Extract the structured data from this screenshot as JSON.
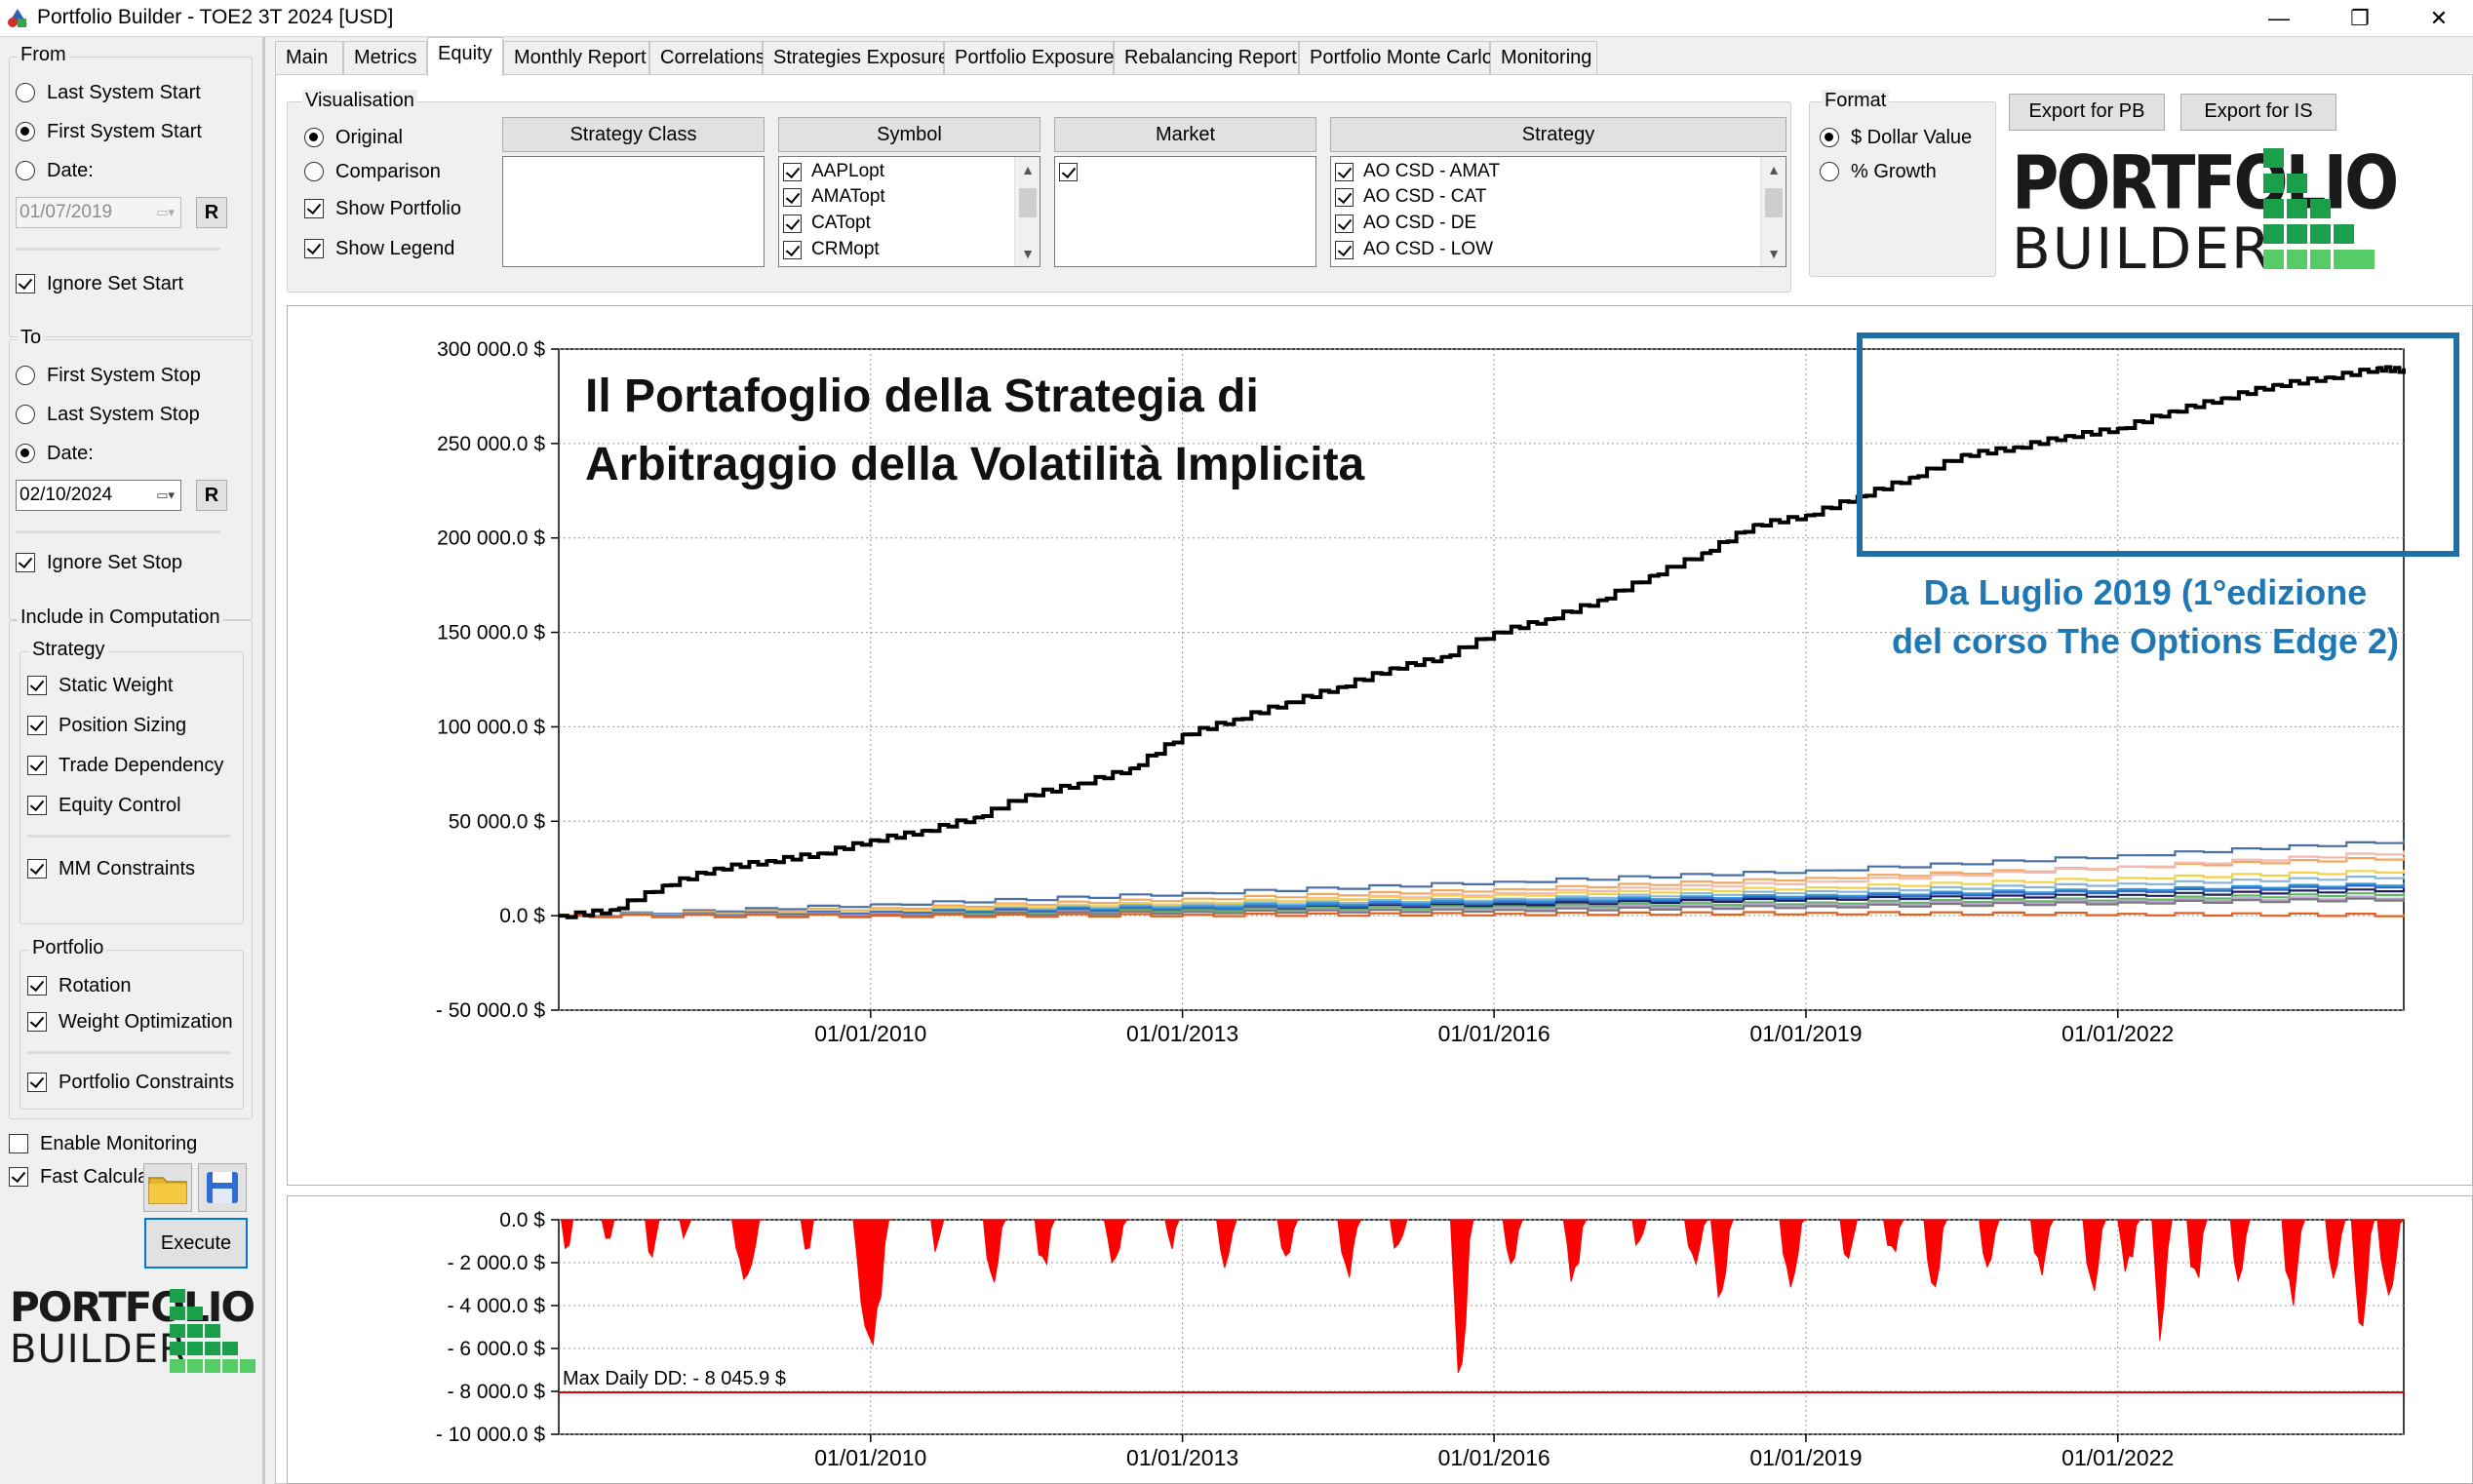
{
  "window": {
    "title": "Portfolio Builder - TOE2 3T 2024 [USD]",
    "controls": {
      "minimize": "—",
      "restore": "❐",
      "close": "✕"
    }
  },
  "left": {
    "from": {
      "label": "From",
      "options": [
        {
          "label": "Last System Start",
          "selected": false
        },
        {
          "label": "First System Start",
          "selected": true
        },
        {
          "label": "Date:",
          "selected": false
        }
      ],
      "date": "01/07/2019",
      "reset_label": "R",
      "ignore_label": "Ignore Set Start",
      "ignore_checked": true
    },
    "to": {
      "label": "To",
      "options": [
        {
          "label": "First System Stop",
          "selected": false
        },
        {
          "label": "Last System Stop",
          "selected": false
        },
        {
          "label": "Date:",
          "selected": true
        }
      ],
      "date": "02/10/2024",
      "reset_label": "R",
      "ignore_label": "Ignore Set Stop",
      "ignore_checked": true
    },
    "include": {
      "label": "Include in Computation",
      "strategy_label": "Strategy",
      "strategy_items": [
        {
          "label": "Static Weight",
          "checked": true
        },
        {
          "label": "Position Sizing",
          "checked": true
        },
        {
          "label": "Trade Dependency",
          "checked": true
        },
        {
          "label": "Equity Control",
          "checked": true
        },
        {
          "label": "MM Constraints",
          "checked": true
        }
      ],
      "portfolio_label": "Portfolio",
      "portfolio_items": [
        {
          "label": "Rotation",
          "checked": true
        },
        {
          "label": "Weight Optimization",
          "checked": true
        },
        {
          "label": "Portfolio Constraints",
          "checked": true
        }
      ]
    },
    "enable_monitoring": {
      "label": "Enable Monitoring",
      "checked": false
    },
    "fast_calculation": {
      "label": "Fast Calculation",
      "checked": true
    },
    "execute_label": "Execute",
    "icons": {
      "open": "folder-icon",
      "save": "floppy-disk-icon"
    }
  },
  "tabs": [
    {
      "label": "Main",
      "active": false
    },
    {
      "label": "Metrics",
      "active": false
    },
    {
      "label": "Equity",
      "active": true
    },
    {
      "label": "Monthly Report",
      "active": false
    },
    {
      "label": "Correlations",
      "active": false
    },
    {
      "label": "Strategies Exposure",
      "active": false
    },
    {
      "label": "Portfolio Exposure",
      "active": false
    },
    {
      "label": "Rebalancing Report",
      "active": false
    },
    {
      "label": "Portfolio Monte Carlo",
      "active": false
    },
    {
      "label": "Monitoring",
      "active": false
    }
  ],
  "visualisation": {
    "label": "Visualisation",
    "options": [
      {
        "label": "Original",
        "selected": true
      },
      {
        "label": "Comparison",
        "selected": false
      }
    ],
    "show_portfolio": {
      "label": "Show Portfolio",
      "checked": true
    },
    "show_legend": {
      "label": "Show Legend",
      "checked": true
    },
    "filters": {
      "strategy_class": {
        "header": "Strategy Class",
        "items": []
      },
      "symbol": {
        "header": "Symbol",
        "items": [
          "AAPLopt",
          "AMATopt",
          "CATopt",
          "CRMopt"
        ]
      },
      "market": {
        "header": "Market",
        "items": [
          ""
        ]
      },
      "strategy": {
        "header": "Strategy",
        "items": [
          "AO CSD - AMAT",
          "AO CSD - CAT",
          "AO CSD - DE",
          "AO CSD - LOW"
        ]
      }
    }
  },
  "format": {
    "label": "Format",
    "options": [
      {
        "label": "$ Dollar Value",
        "selected": true
      },
      {
        "label": "% Growth",
        "selected": false
      }
    ]
  },
  "export": {
    "pb": "Export for PB",
    "is": "Export for IS"
  },
  "logo": {
    "line1": "PORTFOLIO",
    "line2": "BUILDER"
  },
  "overlay": {
    "title_line1": "Il Portafoglio della Strategia di",
    "title_line2": "Arbitraggio della Volatilità Implicita",
    "note_line1": "Da Luglio 2019 (1°edizione",
    "note_line2": "del corso The Options Edge 2)",
    "highlight_color": "#1f6fa6",
    "note_color": "#1f78b4"
  },
  "chart_data": [
    {
      "type": "line",
      "title": "",
      "xlabel": "",
      "ylabel": "",
      "xlim": [
        "2007-01-01",
        "2024-10-02"
      ],
      "ylim": [
        -50000,
        300000
      ],
      "yticks": [
        300000,
        250000,
        200000,
        150000,
        100000,
        50000,
        0,
        -50000
      ],
      "ytick_labels": [
        "300 000.0 $",
        "250 000.0 $",
        "200 000.0 $",
        "150 000.0 $",
        "100 000.0 $",
        "50 000.0 $",
        "0.0 $",
        "- 50 000.0 $"
      ],
      "xticks": [
        "2010-01-01",
        "2013-01-01",
        "2016-01-01",
        "2019-01-01",
        "2022-01-01"
      ],
      "xtick_labels": [
        "01/01/2010",
        "01/01/2013",
        "01/01/2016",
        "01/01/2019",
        "01/01/2022"
      ],
      "grid": true,
      "portfolio": {
        "color": "#000000",
        "x": [
          "2007-01-01",
          "2007-07-01",
          "2008-01-01",
          "2008-07-01",
          "2009-01-01",
          "2009-07-01",
          "2010-01-01",
          "2010-07-01",
          "2011-01-01",
          "2011-07-01",
          "2012-01-01",
          "2012-07-01",
          "2013-01-01",
          "2013-07-01",
          "2014-01-01",
          "2014-07-01",
          "2015-01-01",
          "2015-07-01",
          "2016-01-01",
          "2016-07-01",
          "2017-01-01",
          "2017-07-01",
          "2018-01-01",
          "2018-07-01",
          "2019-01-01",
          "2019-07-01",
          "2020-01-01",
          "2020-07-01",
          "2021-01-01",
          "2021-07-01",
          "2022-01-01",
          "2022-07-01",
          "2023-01-01",
          "2023-07-01",
          "2024-01-01",
          "2024-07-01",
          "2024-10-02"
        ],
        "y": [
          0,
          3000,
          16000,
          25000,
          29000,
          33000,
          40000,
          45000,
          52000,
          64000,
          70000,
          78000,
          96000,
          104000,
          113000,
          121000,
          131000,
          137000,
          150000,
          157000,
          167000,
          180000,
          192000,
          207000,
          212000,
          222000,
          232000,
          244000,
          248000,
          254000,
          258000,
          267000,
          274000,
          281000,
          285000,
          290000,
          289000
        ]
      },
      "series": [
        {
          "color": "#4a6fa5",
          "x": [
            "2007-01-01",
            "2010-01-01",
            "2013-01-01",
            "2016-01-01",
            "2019-01-01",
            "2022-01-01",
            "2024-10-02"
          ],
          "y": [
            0,
            6000,
            12000,
            18000,
            24000,
            32000,
            40000
          ]
        },
        {
          "color": "#f0a860",
          "x": [
            "2007-01-01",
            "2010-01-01",
            "2013-01-01",
            "2016-01-01",
            "2019-01-01",
            "2022-01-01",
            "2024-10-02"
          ],
          "y": [
            0,
            4000,
            9000,
            14000,
            20000,
            26000,
            31000
          ]
        },
        {
          "color": "#f4b8b0",
          "x": [
            "2007-01-01",
            "2010-01-01",
            "2013-01-01",
            "2016-01-01",
            "2019-01-01",
            "2022-01-01",
            "2024-10-02"
          ],
          "y": [
            0,
            3000,
            7000,
            12000,
            18000,
            26000,
            34000
          ]
        },
        {
          "color": "#f2d24a",
          "x": [
            "2007-01-01",
            "2010-01-01",
            "2013-01-01",
            "2016-01-01",
            "2019-01-01",
            "2022-01-01",
            "2024-10-02"
          ],
          "y": [
            0,
            3000,
            7000,
            11000,
            15000,
            20000,
            24000
          ]
        },
        {
          "color": "#8ab4d8",
          "x": [
            "2007-01-01",
            "2010-01-01",
            "2013-01-01",
            "2016-01-01",
            "2019-01-01",
            "2022-01-01",
            "2024-10-02"
          ],
          "y": [
            0,
            2000,
            6000,
            9000,
            13000,
            17000,
            21000
          ]
        },
        {
          "color": "#2e9bd6",
          "x": [
            "2007-01-01",
            "2010-01-01",
            "2013-01-01",
            "2016-01-01",
            "2019-01-01",
            "2022-01-01",
            "2024-10-02"
          ],
          "y": [
            0,
            2000,
            5000,
            8000,
            11000,
            14000,
            17000
          ]
        },
        {
          "color": "#3a66c8",
          "x": [
            "2007-01-01",
            "2010-01-01",
            "2013-01-01",
            "2016-01-01",
            "2019-01-01",
            "2022-01-01",
            "2024-10-02"
          ],
          "y": [
            0,
            2000,
            4000,
            7000,
            10000,
            13000,
            16000
          ]
        },
        {
          "color": "#1f1f5c",
          "x": [
            "2007-01-01",
            "2010-01-01",
            "2013-01-01",
            "2016-01-01",
            "2019-01-01",
            "2022-01-01",
            "2024-10-02"
          ],
          "y": [
            0,
            1000,
            3000,
            6000,
            9000,
            11000,
            14000
          ]
        },
        {
          "color": "#5cb85c",
          "x": [
            "2007-01-01",
            "2010-01-01",
            "2013-01-01",
            "2016-01-01",
            "2019-01-01",
            "2022-01-01",
            "2024-10-02"
          ],
          "y": [
            0,
            1000,
            3000,
            5000,
            7000,
            9000,
            12000
          ]
        },
        {
          "color": "#c0a0d8",
          "x": [
            "2007-01-01",
            "2010-01-01",
            "2013-01-01",
            "2016-01-01",
            "2019-01-01",
            "2022-01-01",
            "2024-10-02"
          ],
          "y": [
            0,
            1000,
            2000,
            4000,
            6000,
            8000,
            10000
          ]
        },
        {
          "color": "#7a7a7a",
          "x": [
            "2007-01-01",
            "2010-01-01",
            "2013-01-01",
            "2016-01-01",
            "2019-01-01",
            "2022-01-01",
            "2024-10-02"
          ],
          "y": [
            0,
            500,
            2000,
            3000,
            5000,
            7000,
            9000
          ]
        },
        {
          "color": "#e06020",
          "x": [
            "2007-01-01",
            "2010-01-01",
            "2013-01-01",
            "2016-01-01",
            "2019-01-01",
            "2022-01-01",
            "2024-10-02"
          ],
          "y": [
            0,
            0,
            500,
            1000,
            1500,
            1000,
            500
          ]
        }
      ]
    },
    {
      "type": "bar",
      "title": "",
      "xlabel": "",
      "ylabel": "",
      "xlim": [
        "2007-01-01",
        "2024-10-02"
      ],
      "ylim": [
        -10000,
        0
      ],
      "yticks": [
        0,
        -2000,
        -4000,
        -6000,
        -8000,
        -10000
      ],
      "ytick_labels": [
        "0.0 $",
        "- 2 000.0 $",
        "- 4 000.0 $",
        "- 6 000.0 $",
        "- 8 000.0 $",
        "- 10 000.0 $"
      ],
      "xticks": [
        "2010-01-01",
        "2013-01-01",
        "2016-01-01",
        "2019-01-01",
        "2022-01-01"
      ],
      "xtick_labels": [
        "01/01/2010",
        "01/01/2013",
        "01/01/2016",
        "01/01/2019",
        "01/01/2022"
      ],
      "grid": true,
      "color": "#ff0000",
      "max_dd_value": -8045.9,
      "max_dd_label": "Max Daily DD: - 8 045.9 $",
      "drawdowns": [
        {
          "start": "2007-01-10",
          "end": "2007-02-20",
          "depth": -1800
        },
        {
          "start": "2007-06-01",
          "end": "2007-07-15",
          "depth": -1300
        },
        {
          "start": "2007-11-01",
          "end": "2007-12-20",
          "depth": -2100
        },
        {
          "start": "2008-03-01",
          "end": "2008-04-10",
          "depth": -900
        },
        {
          "start": "2008-09-01",
          "end": "2008-12-20",
          "depth": -3000
        },
        {
          "start": "2009-05-01",
          "end": "2009-06-15",
          "depth": -2000
        },
        {
          "start": "2009-11-01",
          "end": "2010-03-20",
          "depth": -6300
        },
        {
          "start": "2010-08-01",
          "end": "2010-09-15",
          "depth": -1600
        },
        {
          "start": "2011-02-01",
          "end": "2011-04-20",
          "depth": -3200
        },
        {
          "start": "2011-08-01",
          "end": "2011-10-10",
          "depth": -2500
        },
        {
          "start": "2012-04-01",
          "end": "2012-06-20",
          "depth": -2200
        },
        {
          "start": "2012-11-01",
          "end": "2012-12-20",
          "depth": -1400
        },
        {
          "start": "2013-05-01",
          "end": "2013-07-10",
          "depth": -2400
        },
        {
          "start": "2013-12-01",
          "end": "2014-02-10",
          "depth": -2000
        },
        {
          "start": "2014-07-01",
          "end": "2014-09-20",
          "depth": -2800
        },
        {
          "start": "2015-01-01",
          "end": "2015-03-01",
          "depth": -1700
        },
        {
          "start": "2015-08-01",
          "end": "2015-10-20",
          "depth": -8000
        },
        {
          "start": "2016-02-01",
          "end": "2016-04-10",
          "depth": -2300
        },
        {
          "start": "2016-09-01",
          "end": "2016-11-20",
          "depth": -3100
        },
        {
          "start": "2017-05-01",
          "end": "2017-06-20",
          "depth": -1500
        },
        {
          "start": "2017-11-01",
          "end": "2018-01-20",
          "depth": -2200
        },
        {
          "start": "2018-02-01",
          "end": "2018-04-20",
          "depth": -4000
        },
        {
          "start": "2018-10-01",
          "end": "2018-12-30",
          "depth": -3300
        },
        {
          "start": "2019-05-01",
          "end": "2019-06-30",
          "depth": -2200
        },
        {
          "start": "2019-10-01",
          "end": "2019-12-10",
          "depth": -1800
        },
        {
          "start": "2020-02-20",
          "end": "2020-05-10",
          "depth": -3600
        },
        {
          "start": "2020-09-01",
          "end": "2020-11-10",
          "depth": -2500
        },
        {
          "start": "2021-03-01",
          "end": "2021-05-20",
          "depth": -2700
        },
        {
          "start": "2021-09-01",
          "end": "2021-11-20",
          "depth": -3600
        },
        {
          "start": "2022-01-01",
          "end": "2022-03-20",
          "depth": -2600
        },
        {
          "start": "2022-05-01",
          "end": "2022-07-10",
          "depth": -5800
        },
        {
          "start": "2022-09-01",
          "end": "2022-11-10",
          "depth": -3300
        },
        {
          "start": "2023-02-01",
          "end": "2023-04-10",
          "depth": -3200
        },
        {
          "start": "2023-08-01",
          "end": "2023-10-20",
          "depth": -4200
        },
        {
          "start": "2024-01-01",
          "end": "2024-03-10",
          "depth": -3000
        },
        {
          "start": "2024-04-01",
          "end": "2024-06-20",
          "depth": -5600
        },
        {
          "start": "2024-07-01",
          "end": "2024-10-02",
          "depth": -3800
        }
      ]
    }
  ]
}
